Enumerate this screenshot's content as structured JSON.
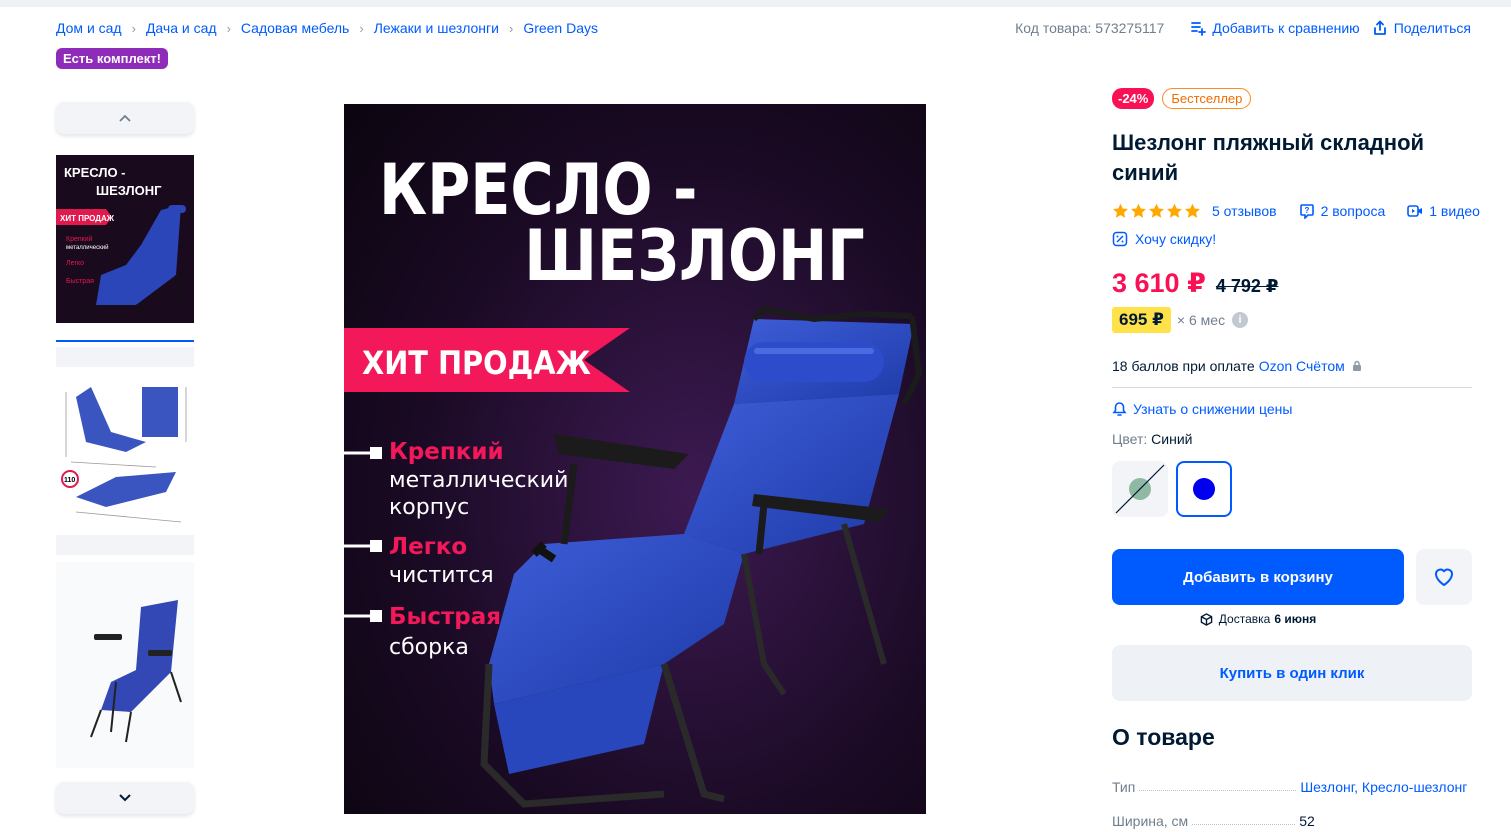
{
  "breadcrumbs": [
    "Дом и сад",
    "Дача и сад",
    "Садовая мебель",
    "Лежаки и шезлонги",
    "Green Days"
  ],
  "product_code": "Код товара: 573275117",
  "actions": {
    "compare": "Добавить к сравнению",
    "share": "Поделиться"
  },
  "kit_badge": "Есть комплект!",
  "main_image": {
    "title_line1": "КРЕСЛО -",
    "title_line2": "ШЕЗЛОНГ",
    "ribbon": "ХИТ ПРОДАЖ",
    "features": [
      {
        "highlight": "Крепкий",
        "rest1": "металлический",
        "rest2": "корпус"
      },
      {
        "highlight": "Легко",
        "rest1": "чистится",
        "rest2": ""
      },
      {
        "highlight": "Быстрая",
        "rest1": "сборка",
        "rest2": ""
      }
    ]
  },
  "badges": {
    "discount": "-24%",
    "bestseller": "Бестселлер"
  },
  "product_title": "Шезлонг пляжный складной синий",
  "rating": {
    "stars": 5,
    "reviews": "5 отзывов",
    "questions": "2 вопроса",
    "videos": "1 видео"
  },
  "want_discount": "Хочу скидку!",
  "price": {
    "current": "3 610 ₽",
    "old": "4 792 ₽"
  },
  "installment": {
    "amount": "695 ₽",
    "term": "× 6 мес",
    "info": "i"
  },
  "points": {
    "text": "18 баллов при оплате",
    "link": "Ozon Счётом"
  },
  "notify_price": "Узнать о снижении цены",
  "color": {
    "label": "Цвет:",
    "value": "Синий",
    "swatches": [
      "#8fb9a3",
      "#0000ee"
    ]
  },
  "buttons": {
    "add_to_cart": "Добавить в корзину",
    "one_click": "Купить в один клик"
  },
  "delivery": {
    "label": "Доставка",
    "date": "6 июня"
  },
  "about": {
    "title": "О товаре",
    "specs": [
      {
        "key": "Тип",
        "value": "Шезлонг, Кресло-шезлонг"
      },
      {
        "key": "Ширина, см",
        "value": "52"
      }
    ]
  },
  "colors": {
    "accent": "#005bff",
    "price": "#f91155",
    "badge_purple": "#8e2bb8",
    "installment": "#ffe24a"
  }
}
